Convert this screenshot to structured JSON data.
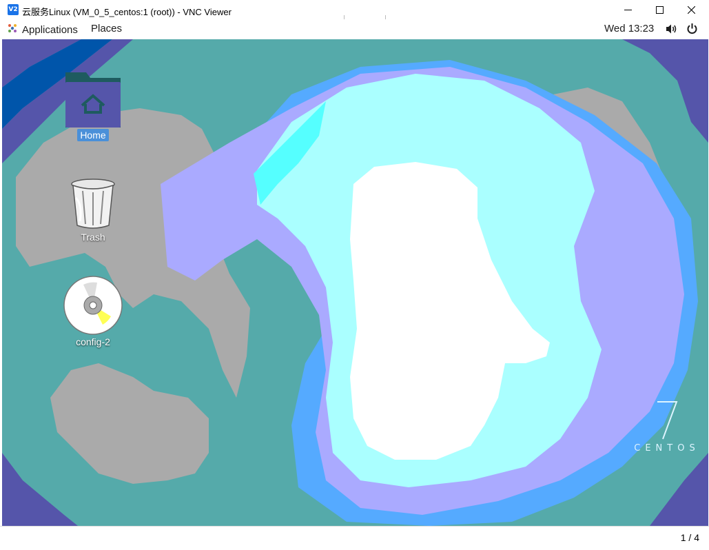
{
  "window": {
    "app_icon_text": "V2",
    "title": "云服务Linux (VM_0_5_centos:1 (root)) - VNC Viewer",
    "minimize_icon": "minimize-icon",
    "maximize_icon": "maximize-icon",
    "close_icon": "close-icon"
  },
  "topbar": {
    "applications_label": "Applications",
    "places_label": "Places",
    "clock": "Wed 13:23",
    "volume_icon": "volume-icon",
    "power_icon": "power-icon"
  },
  "desktop": {
    "icons": [
      {
        "label": "Home",
        "icon": "home-folder-icon",
        "selected": true
      },
      {
        "label": "Trash",
        "icon": "trash-icon",
        "selected": false
      },
      {
        "label": "config-2",
        "icon": "optical-disc-icon",
        "selected": false
      }
    ],
    "brand": {
      "numeral": "7",
      "word": "CENTOS"
    }
  },
  "status": {
    "page_indicator": "1 / 4"
  },
  "colors": {
    "desktop_base": "#55aaaa",
    "lavender": "#aaaaff",
    "light_cyan": "#aaffff",
    "bright_blue": "#55aaff",
    "gray": "#aaaaaa",
    "dark_purple": "#5555aa",
    "selection": "#4a90d9"
  }
}
